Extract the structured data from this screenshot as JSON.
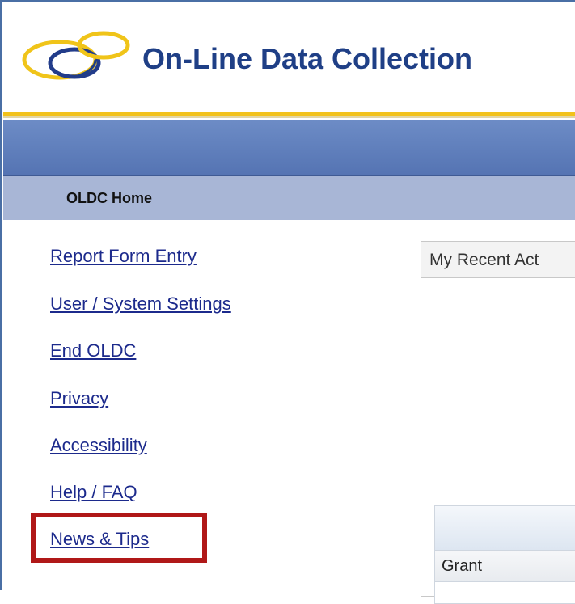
{
  "header": {
    "app_title": "On-Line Data Collection",
    "logo_icon": "overlapping-rings-logo"
  },
  "subnav": {
    "title": "OLDC Home"
  },
  "sidebar": {
    "items": [
      {
        "label": "Report Form Entry"
      },
      {
        "label": "User / System Settings"
      },
      {
        "label": "End OLDC"
      },
      {
        "label": "Privacy"
      },
      {
        "label": "Accessibility"
      },
      {
        "label": "Help / FAQ"
      },
      {
        "label": "News & Tips"
      }
    ]
  },
  "panel": {
    "title": "My Recent Act",
    "grid": {
      "columns": [
        "Grant"
      ]
    }
  },
  "colors": {
    "title_blue": "#1f3f86",
    "gold_rule": "#f2c21b",
    "nav_blue": "#5f7fbd",
    "subnav_bg": "#a8b6d6",
    "link_color": "#1c2a8c",
    "highlight_red": "#b01818"
  }
}
